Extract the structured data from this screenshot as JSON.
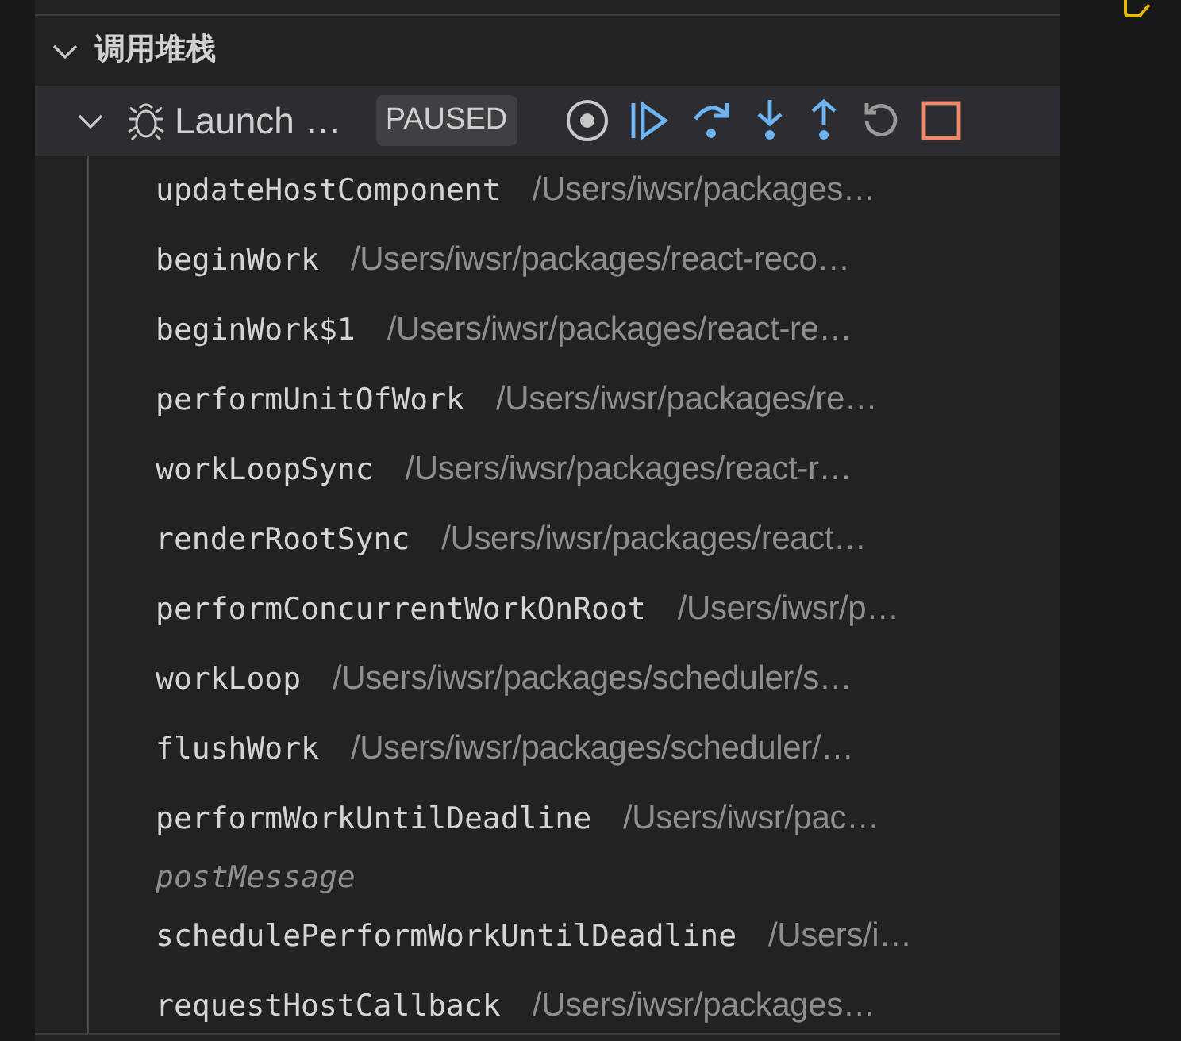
{
  "call_stack": {
    "title": "调用堆栈",
    "expanded": true,
    "session": {
      "name": "Launch …",
      "expanded": true,
      "status": "PAUSED"
    },
    "frames": [
      {
        "kind": "frame",
        "function": "updateHostComponent",
        "path": "/Users/iwsr/packages…"
      },
      {
        "kind": "frame",
        "function": "beginWork",
        "path": "/Users/iwsr/packages/react-reco…"
      },
      {
        "kind": "frame",
        "function": "beginWork$1",
        "path": "/Users/iwsr/packages/react-re…"
      },
      {
        "kind": "frame",
        "function": "performUnitOfWork",
        "path": "/Users/iwsr/packages/re…"
      },
      {
        "kind": "frame",
        "function": "workLoopSync",
        "path": "/Users/iwsr/packages/react-r…"
      },
      {
        "kind": "frame",
        "function": "renderRootSync",
        "path": "/Users/iwsr/packages/react…"
      },
      {
        "kind": "frame",
        "function": "performConcurrentWorkOnRoot",
        "path": "/Users/iwsr/p…"
      },
      {
        "kind": "frame",
        "function": "workLoop",
        "path": "/Users/iwsr/packages/scheduler/s…"
      },
      {
        "kind": "frame",
        "function": "flushWork",
        "path": "/Users/iwsr/packages/scheduler/…"
      },
      {
        "kind": "frame",
        "function": "performWorkUntilDeadline",
        "path": "/Users/iwsr/pac…"
      },
      {
        "kind": "label",
        "text": "postMessage"
      },
      {
        "kind": "frame",
        "function": "schedulePerformWorkUntilDeadline",
        "path": "/Users/i…"
      },
      {
        "kind": "frame",
        "function": "requestHostCallback",
        "path": "/Users/iwsr/packages…"
      }
    ]
  }
}
